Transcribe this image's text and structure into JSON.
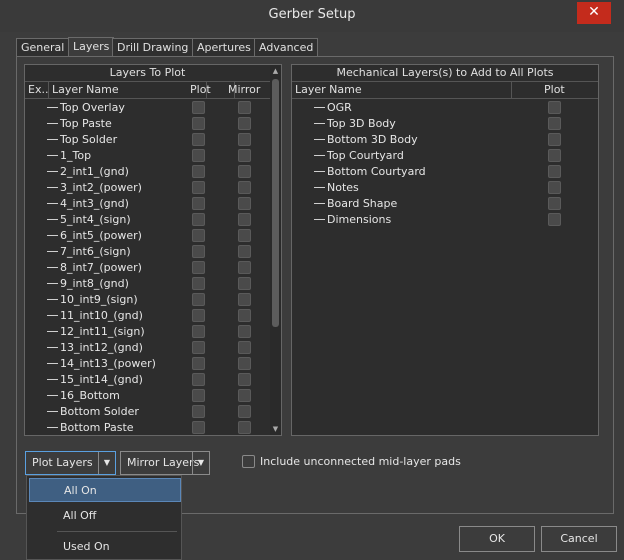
{
  "window": {
    "title": "Gerber Setup",
    "close_glyph": "✕"
  },
  "tabs": [
    {
      "label": "General"
    },
    {
      "label": "Layers"
    },
    {
      "label": "Drill Drawing"
    },
    {
      "label": "Apertures"
    },
    {
      "label": "Advanced"
    }
  ],
  "layers_panel": {
    "title": "Layers To Plot",
    "columns": {
      "expand": "Ex...",
      "name": "Layer Name",
      "plot": "Plot",
      "mirror": "Mirror"
    },
    "rows": [
      "Top Overlay",
      "Top Paste",
      "Top Solder",
      "1_Top",
      "2_int1_(gnd)",
      "3_int2_(power)",
      "4_int3_(gnd)",
      "5_int4_(sign)",
      "6_int5_(power)",
      "7_int6_(sign)",
      "8_int7_(power)",
      "9_int8_(gnd)",
      "10_int9_(sign)",
      "11_int10_(gnd)",
      "12_int11_(sign)",
      "13_int12_(gnd)",
      "14_int13_(power)",
      "15_int14_(gnd)",
      "16_Bottom",
      "Bottom Solder",
      "Bottom Paste"
    ]
  },
  "mech_panel": {
    "title": "Mechanical Layers(s) to Add to All Plots",
    "columns": {
      "name": "Layer Name",
      "plot": "Plot"
    },
    "rows": [
      "OGR",
      "Top 3D Body",
      "Bottom 3D Body",
      "Top Courtyard",
      "Bottom Courtyard",
      "Notes",
      "Board Shape",
      "Dimensions"
    ]
  },
  "controls": {
    "plot_layers_label": "Plot Layers",
    "mirror_layers_label": "Mirror Layers",
    "include_unconnected_label": "Include unconnected mid-layer pads"
  },
  "dropdown_menu": {
    "items": [
      "All On",
      "All Off",
      "Used On"
    ],
    "highlighted": "All On"
  },
  "buttons": {
    "ok": "OK",
    "cancel": "Cancel"
  }
}
